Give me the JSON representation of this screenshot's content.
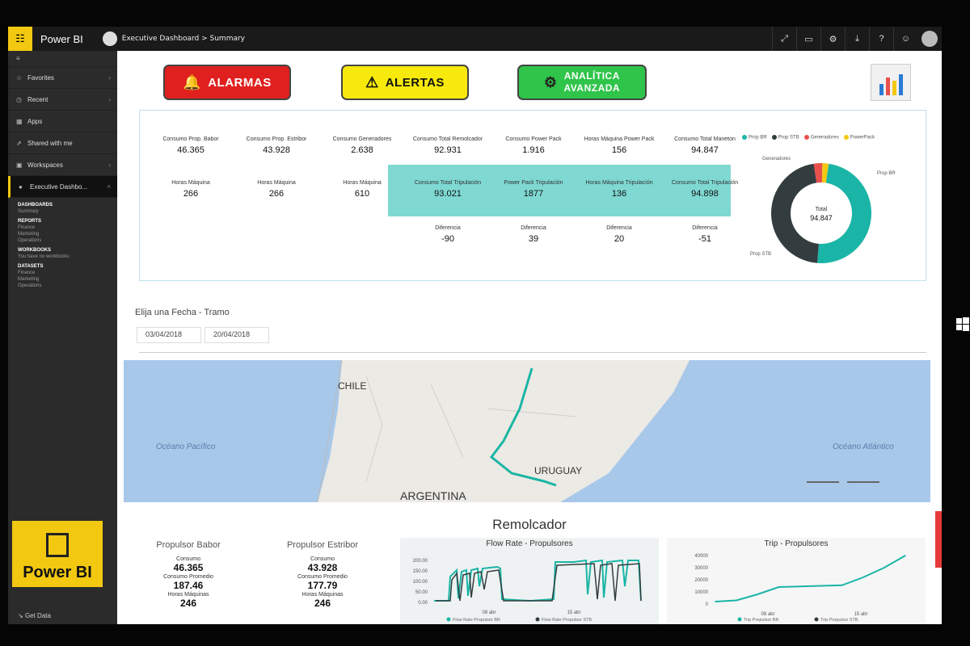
{
  "app": {
    "name": "Power BI",
    "breadcrumb": "Executive Dashboard > Summary"
  },
  "sidebar": {
    "items": [
      {
        "label": "Favorites",
        "icon": "star-icon",
        "chevron": true
      },
      {
        "label": "Recent",
        "icon": "clock-icon",
        "chevron": true
      },
      {
        "label": "Apps",
        "icon": "apps-icon",
        "chevron": false
      },
      {
        "label": "Shared with me",
        "icon": "share-icon",
        "chevron": false
      },
      {
        "label": "Workspaces",
        "icon": "workspaces-icon",
        "chevron": true
      },
      {
        "label": "Executive Dashbo...",
        "icon": "workspace-avatar-icon",
        "chevron": true
      }
    ],
    "dashboards_header": "DASHBOARDS",
    "dashboards": [
      "Summary"
    ],
    "reports_header": "REPORTS",
    "reports": [
      "Finance",
      "Marketing",
      "Operations"
    ],
    "workbooks_header": "WORKBOOKS",
    "workbooks": [
      "You have no workbooks"
    ],
    "datasets_header": "DATASETS",
    "datasets": [
      "Finance",
      "Marketing",
      "Operations"
    ],
    "logo_text": "Power BI",
    "get_data": "Get Data"
  },
  "buttons": {
    "alarm": "ALARMAS",
    "alert": "ALERTAS",
    "analytics_1": "ANALÍTICA",
    "analytics_2": "AVANZADA"
  },
  "kpis": {
    "row1": [
      {
        "label": "Consumo Prop. Babor",
        "value": "46.365"
      },
      {
        "label": "Consumo Prop. Estribor",
        "value": "43.928"
      },
      {
        "label": "Consumo Generadores",
        "value": "2.638"
      },
      {
        "label": "Consumo Total Remolcador",
        "value": "92.931"
      },
      {
        "label": "Consumo Power Pack",
        "value": "1.916"
      },
      {
        "label": "Horas Máquina Power Pack",
        "value": "156"
      },
      {
        "label": "Consumo Total Maneton",
        "value": "94.847"
      }
    ],
    "row2": [
      {
        "label": "Horas Máquina",
        "value": "266"
      },
      {
        "label": "Horas Máquina",
        "value": "266"
      },
      {
        "label": "Horas Máquina",
        "value": "610"
      },
      {
        "label": "Consumo Total Tripulación",
        "value": "93.021"
      },
      {
        "label": "Power Pack Tripulación",
        "value": "1877"
      },
      {
        "label": "Horas Máquina Tripulación",
        "value": "136"
      },
      {
        "label": "Consumo Total Tripulación",
        "value": "94.898"
      }
    ],
    "row3": [
      {
        "label": "Diferencia",
        "value": "-90"
      },
      {
        "label": "Diferencia",
        "value": "39"
      },
      {
        "label": "Diferencia",
        "value": "20"
      },
      {
        "label": "Diferencia",
        "value": "-51"
      }
    ]
  },
  "donut": {
    "legend": [
      {
        "name": "Prop BR",
        "color": "#1ab5a6"
      },
      {
        "name": "Prop STB",
        "color": "#333d3f"
      },
      {
        "name": "Generadores",
        "color": "#e8504c"
      },
      {
        "name": "PowerPack",
        "color": "#f2c811"
      }
    ],
    "label_generadores": "Generadores",
    "label_prop_br": "Prop BR",
    "label_prop_stb": "Prop STB",
    "center_label": "Total",
    "center_value": "94.847",
    "values": [
      46.365,
      43.928,
      2.638,
      1.916
    ]
  },
  "date_filter": {
    "label": "Elija una Fecha - Tramo",
    "from": "03/04/2018",
    "to": "20/04/2018"
  },
  "map": {
    "labels": {
      "chile": "CHILE",
      "argentina": "ARGENTINA",
      "uruguay": "URUGUAY",
      "pacific": "Océano Pacífico",
      "atlantic": "Océano Atlántico"
    }
  },
  "remolcador": {
    "title": "Remolcador",
    "babor": {
      "header": "Propulsor Babor",
      "consumo_label": "Consumo",
      "consumo": "46.365",
      "promedio_label": "Consumo Promedio",
      "promedio": "187.46",
      "horas_label": "Horas Máquinas",
      "horas": "246"
    },
    "estribor": {
      "header": "Propulsor Estribor",
      "consumo_label": "Consumo",
      "consumo": "43.928",
      "promedio_label": "Consumo Promedio",
      "promedio": "177.79",
      "horas_label": "Horas Máquinas",
      "horas": "246"
    }
  },
  "chart_data": [
    {
      "type": "line",
      "title": "Flow Rate - Propulsores",
      "x_ticks": [
        "08 abr",
        "15 abr"
      ],
      "y_ticks": [
        "0.00",
        "50.00",
        "100.00",
        "150.00",
        "200.00"
      ],
      "ylim": [
        0,
        200
      ],
      "series": [
        {
          "name": "Flow Rate Propulsor BR",
          "color": "#1ab5a6"
        },
        {
          "name": "Flow Rate Propulsor STB",
          "color": "#333d3f"
        }
      ]
    },
    {
      "type": "line",
      "title": "Trip - Propulsores",
      "x_ticks": [
        "08 abr",
        "15 abr"
      ],
      "y_ticks": [
        "0",
        "10000",
        "20000",
        "30000",
        "40000"
      ],
      "ylim": [
        0,
        40000
      ],
      "series": [
        {
          "name": "Trip Propulsor BR",
          "color": "#1ab5a6",
          "values": [
            2000,
            3000,
            8000,
            14000,
            14500,
            15000,
            15500,
            22000,
            30000,
            40000
          ]
        },
        {
          "name": "Trip Propulsor STB",
          "color": "#333d3f"
        }
      ]
    }
  ]
}
